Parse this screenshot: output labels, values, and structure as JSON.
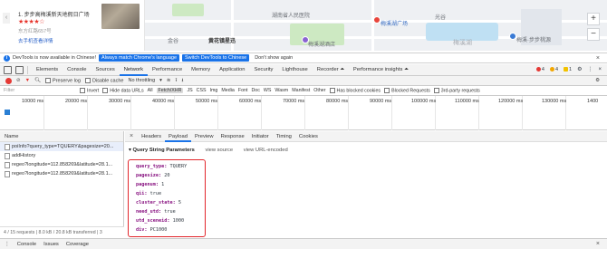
{
  "map": {
    "place_title": "1. 步步高梅溪新天地假日广场",
    "stars": "★★★★☆",
    "address": "东方红路657号",
    "link": "去手机查看详情",
    "labels": [
      "金谷",
      "黄花镇星迅",
      "光谷",
      "梅溪湖广场",
      "梅溪湖酒店",
      "梅溪·步步桃源",
      "湖南省人民医院",
      "梅溪湖"
    ],
    "zoom_in": "+",
    "zoom_out": "−"
  },
  "infobar": {
    "text": "DevTools is now available in Chinese!",
    "btn_match": "Always match Chrome's language",
    "btn_switch": "Switch DevTools to Chinese",
    "dont_show": "Don't show again",
    "close": "×"
  },
  "devtools_tabs": {
    "tabs": [
      "Elements",
      "Console",
      "Sources",
      "Network",
      "Performance",
      "Memory",
      "Application",
      "Security",
      "Lighthouse",
      "Recorder ⏶",
      "Performance insights ⏶"
    ],
    "active": "Network",
    "errors": "4",
    "warnings": "4",
    "info": "1",
    "more": "⋮",
    "close": "×"
  },
  "network_toolbar": {
    "preserve_log": "Preserve log",
    "disable_cache": "Disable cache",
    "throttling": "No throttling",
    "upload": "⭱",
    "download": "⭳"
  },
  "filter": {
    "placeholder": "Filter",
    "invert": "Invert",
    "hide_data_urls": "Hide data URLs",
    "types": [
      "All",
      "Fetch/XHR",
      "JS",
      "CSS",
      "Img",
      "Media",
      "Font",
      "Doc",
      "WS",
      "Wasm",
      "Manifest",
      "Other"
    ],
    "active_type": "Fetch/XHR",
    "blocked_cookies": "Has blocked cookies",
    "blocked_requests": "Blocked Requests",
    "third_party": "3rd-party requests"
  },
  "timeline": {
    "ticks": [
      "10000 ms",
      "20000 ms",
      "30000 ms",
      "40000 ms",
      "50000 ms",
      "60000 ms",
      "70000 ms",
      "80000 ms",
      "90000 ms",
      "100000 ms",
      "110000 ms",
      "120000 ms",
      "130000 ms",
      "1400"
    ]
  },
  "requests": {
    "header": "Name",
    "items": [
      "poiInfo?query_type=TQUERY&pagesize=20...",
      "addHistory",
      "regeo?longitude=112.858269&latitude=28.1...",
      "regeo?longitude=112.858269&latitude=28.1..."
    ],
    "footer": "4 / 15 requests  |  8.0 kB / 20.8 kB transferred  |  3"
  },
  "detail": {
    "tabs": [
      "Headers",
      "Payload",
      "Preview",
      "Response",
      "Initiator",
      "Timing",
      "Cookies"
    ],
    "active": "Payload",
    "close": "×",
    "section": "▾ Query String Parameters",
    "view_source": "view source",
    "view_url": "view URL-encoded",
    "params": [
      {
        "k": "query_type:",
        "v": "TQUERY"
      },
      {
        "k": "pagesize:",
        "v": "20"
      },
      {
        "k": "pagenum:",
        "v": "1"
      },
      {
        "k": "qii:",
        "v": "true"
      },
      {
        "k": "cluster_state:",
        "v": "5"
      },
      {
        "k": "need_utd:",
        "v": "true"
      },
      {
        "k": "utd_sceneid:",
        "v": "1000"
      },
      {
        "k": "div:",
        "v": "PC1000"
      }
    ]
  },
  "drawer": {
    "menu": "⋮",
    "tabs": [
      "Console",
      "Issues",
      "Coverage"
    ],
    "close": "×"
  },
  "colors": {
    "accent": "#1a73e8",
    "highlight_box": "#e2262b",
    "record": "#e53935"
  }
}
